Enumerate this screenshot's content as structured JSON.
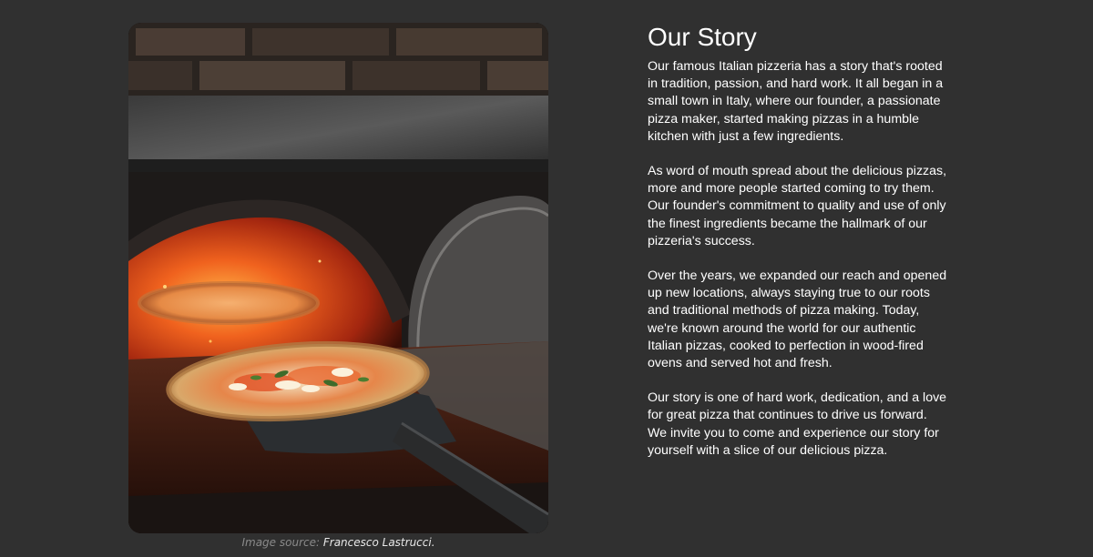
{
  "story": {
    "title": "Our Story",
    "paragraphs": [
      "Our famous Italian pizzeria has a story that's rooted in tradition, passion, and hard work. It all began in a small town in Italy, where our founder, a passionate pizza maker, started making pizzas in a humble kitchen with just a few ingredients.",
      "As word of mouth spread about the delicious pizzas, more and more people started coming to try them. Our founder's commitment to quality and use of only the finest ingredients became the hallmark of our pizzeria's success.",
      "Over the years, we expanded our reach and opened up new locations, always staying true to our roots and traditional methods of pizza making. Today, we're known around the world for our authentic Italian pizzas, cooked to perfection in wood-fired ovens and served hot and fresh.",
      "Our story is one of hard work, dedication, and a love for great pizza that continues to drive us forward. We invite you to come and experience our story for yourself with a slice of our delicious pizza."
    ]
  },
  "image": {
    "caption_prefix": "Image source:",
    "caption_credit": "Francesco Lastrucci."
  },
  "colors": {
    "background": "#303030",
    "text": "#ffffff",
    "caption_muted": "#8a8a8a"
  }
}
